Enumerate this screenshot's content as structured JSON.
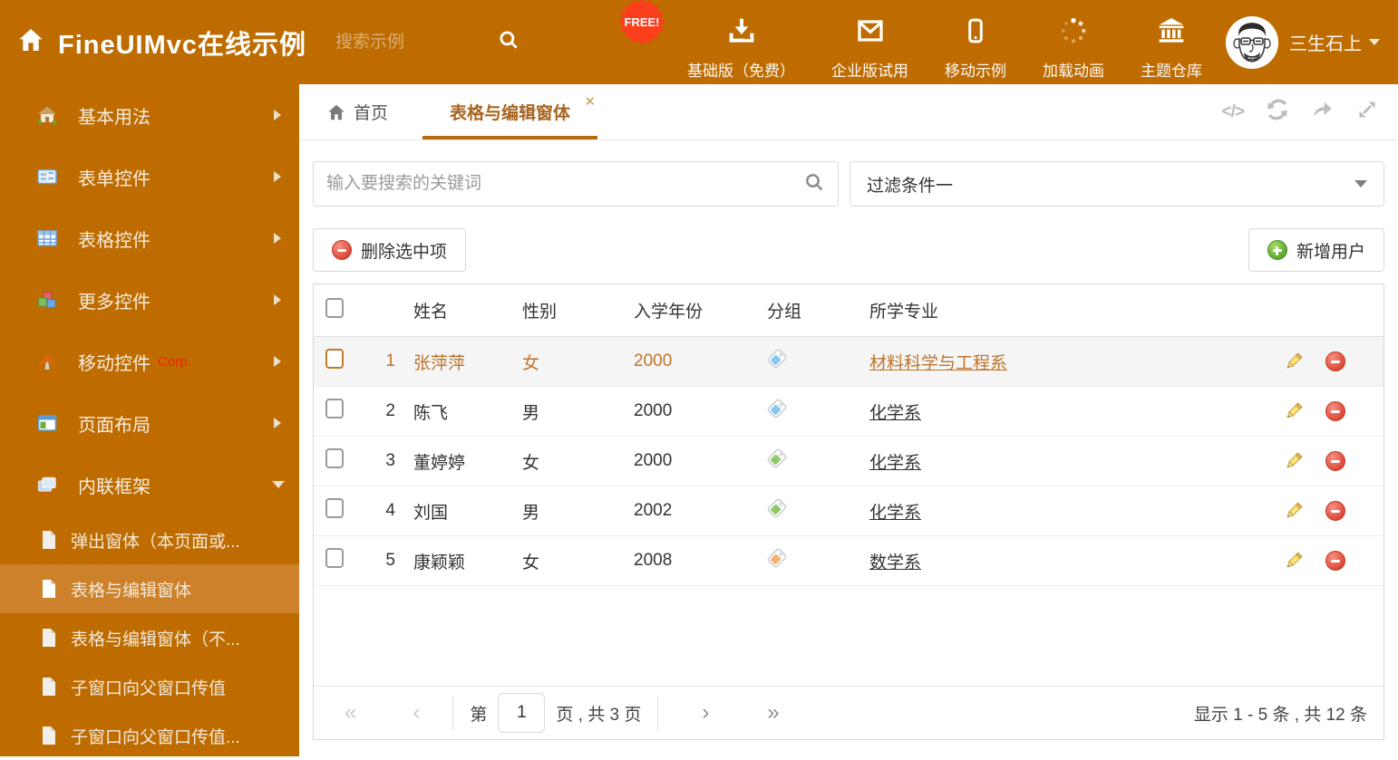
{
  "header": {
    "title": "FineUIMvc在线示例",
    "search_placeholder": "搜索示例",
    "free_badge": "FREE!",
    "nav_items": [
      {
        "label": "基础版（免费）",
        "icon": "download-icon"
      },
      {
        "label": "企业版试用",
        "icon": "envelope-icon"
      },
      {
        "label": "移动示例",
        "icon": "mobile-icon"
      },
      {
        "label": "加载动画",
        "icon": "spinner-icon"
      },
      {
        "label": "主题仓库",
        "icon": "bank-icon"
      }
    ],
    "username": "三生石上"
  },
  "sidebar": {
    "items": [
      {
        "label": "基本用法",
        "icon": "house-icon"
      },
      {
        "label": "表单控件",
        "icon": "form-icon"
      },
      {
        "label": "表格控件",
        "icon": "table-icon"
      },
      {
        "label": "更多控件",
        "icon": "cubes-icon"
      },
      {
        "label": "移动控件",
        "badge": "Corp.",
        "icon": "antenna-icon"
      },
      {
        "label": "页面布局",
        "icon": "layout-icon"
      },
      {
        "label": "内联框架",
        "icon": "frames-icon"
      }
    ],
    "subitems": [
      {
        "label": "弹出窗体（本页面或..."
      },
      {
        "label": "表格与编辑窗体"
      },
      {
        "label": "表格与编辑窗体（不..."
      },
      {
        "label": "子窗口向父窗口传值"
      },
      {
        "label": "子窗口向父窗口传值..."
      }
    ]
  },
  "tabs": {
    "home_tab": "首页",
    "active_tab": "表格与编辑窗体"
  },
  "filters": {
    "search_placeholder": "输入要搜索的关键词",
    "filter_value": "过滤条件一"
  },
  "toolbar": {
    "delete_label": "删除选中项",
    "add_label": "新增用户"
  },
  "table": {
    "columns": {
      "name": "姓名",
      "gender": "性别",
      "year": "入学年份",
      "group": "分组",
      "major": "所学专业"
    },
    "rows": [
      {
        "num": "1",
        "name": "张萍萍",
        "gender": "女",
        "year": "2000",
        "tag_color": "#85C8F2",
        "major": "材料科学与工程系"
      },
      {
        "num": "2",
        "name": "陈飞",
        "gender": "男",
        "year": "2000",
        "tag_color": "#85C8F2",
        "major": "化学系"
      },
      {
        "num": "3",
        "name": "董婷婷",
        "gender": "女",
        "year": "2000",
        "tag_color": "#8FC868",
        "major": "化学系"
      },
      {
        "num": "4",
        "name": "刘国",
        "gender": "男",
        "year": "2002",
        "tag_color": "#8FC868",
        "major": "化学系"
      },
      {
        "num": "5",
        "name": "康颖颖",
        "gender": "女",
        "year": "2008",
        "tag_color": "#F5B16A",
        "major": "数学系"
      }
    ]
  },
  "pagination": {
    "prefix": "第",
    "current_page": "1",
    "suffix": "页 , 共 3 页",
    "summary": "显示 1 - 5 条 , 共 12 条"
  },
  "colors": {
    "brand_orange": "#BE6C00",
    "sidebar_selected": "#CC812A",
    "free_badge_red": "#FB3E1C",
    "active_tab_text": "#A9641F",
    "highlight_row_text": "#BE742A"
  }
}
